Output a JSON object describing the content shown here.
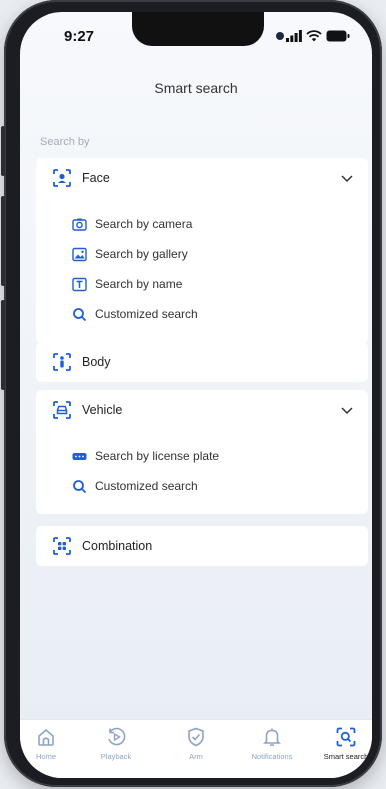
{
  "status_bar": {
    "time": "9:27"
  },
  "header": {
    "title": "Smart search"
  },
  "search_by_label": "Search by",
  "categories": [
    {
      "label": "Face",
      "icon": "face-scan-icon",
      "expanded": true,
      "items": [
        {
          "label": "Search by camera",
          "icon": "camera-icon"
        },
        {
          "label": "Search by gallery",
          "icon": "gallery-icon"
        },
        {
          "label": "Search by name",
          "icon": "text-icon"
        },
        {
          "label": "Customized search",
          "icon": "search-icon"
        }
      ]
    },
    {
      "label": "Body",
      "icon": "body-scan-icon",
      "expanded": false
    },
    {
      "label": "Vehicle",
      "icon": "vehicle-scan-icon",
      "expanded": true,
      "items": [
        {
          "label": "Search by license plate",
          "icon": "license-plate-icon"
        },
        {
          "label": "Customized search",
          "icon": "search-icon"
        }
      ]
    },
    {
      "label": "Combination",
      "icon": "combination-scan-icon",
      "expanded": false
    }
  ],
  "tabbar": {
    "tabs": [
      {
        "label": "Home",
        "icon": "home-icon"
      },
      {
        "label": "Playback",
        "icon": "playback-icon"
      },
      {
        "label": "Arm",
        "icon": "shield-icon"
      },
      {
        "label": "Notifications",
        "icon": "bell-icon"
      },
      {
        "label": "Smart search",
        "icon": "smart-search-icon",
        "active": true
      }
    ]
  },
  "colors": {
    "accent": "#1f5fd6",
    "tab_inactive": "#8fa3c4",
    "section_label": "#a5acb8"
  }
}
